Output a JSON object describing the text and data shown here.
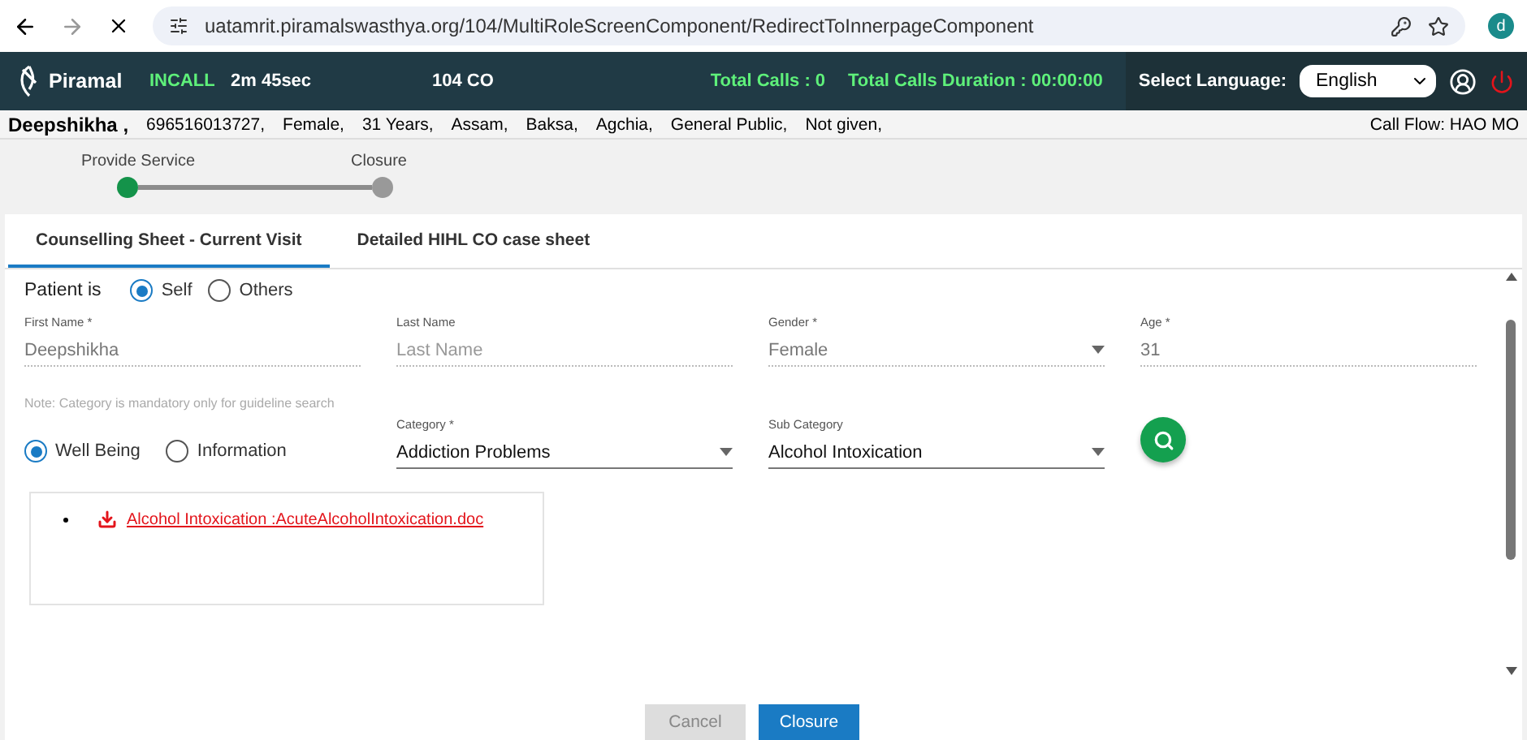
{
  "browser": {
    "url": "uatamrit.piramalswasthya.org/104/MultiRoleScreenComponent/RedirectToInnerpageComponent",
    "profile_initial": "d"
  },
  "header": {
    "brand": "Piramal",
    "call_status": "INCALL",
    "call_time": "2m 45sec",
    "role": "104 CO",
    "total_calls": "Total Calls : 0",
    "total_duration": "Total Calls Duration : 00:00:00",
    "language_label": "Select Language:",
    "language": "English"
  },
  "patient_strip": {
    "name": "Deepshikha ,",
    "details": [
      "696516013727,",
      "Female,",
      "31 Years,",
      "Assam,",
      "Baksa,",
      "Agchia,",
      "General Public,",
      "Not given,"
    ],
    "call_flow": "Call Flow: HAO MO"
  },
  "stepper": [
    {
      "label": "Provide Service",
      "selected": true
    },
    {
      "label": "Closure",
      "selected": false
    }
  ],
  "tabs": [
    {
      "label": "Counselling Sheet - Current Visit",
      "selected": true
    },
    {
      "label": "Detailed HIHL CO case sheet",
      "selected": false
    }
  ],
  "patient_is": {
    "label": "Patient is",
    "options": [
      {
        "label": "Self",
        "selected": true
      },
      {
        "label": "Others",
        "selected": false
      }
    ]
  },
  "fields": [
    {
      "label": "First Name *",
      "value": "Deepshikha",
      "kind": "readonly"
    },
    {
      "label": "Last Name",
      "placeholder": "Last Name",
      "kind": "readonly"
    },
    {
      "label": "Gender *",
      "value": "Female",
      "kind": "readonly-select"
    },
    {
      "label": "Age *",
      "value": "31",
      "kind": "readonly"
    }
  ],
  "note": "Note: Category is mandatory only for guideline search",
  "service_type": [
    {
      "label": "Well Being",
      "selected": true
    },
    {
      "label": "Information",
      "selected": false
    }
  ],
  "category_fields": [
    {
      "label": "Category *",
      "value": "Addiction Problems",
      "kind": "select"
    },
    {
      "label": "Sub Category",
      "value": "Alcohol Intoxication",
      "kind": "select"
    }
  ],
  "guidelines": [
    "Alcohol Intoxication :AcuteAlcoholIntoxication.doc"
  ],
  "buttons": [
    {
      "label": "Cancel",
      "disabled": true
    },
    {
      "label": "Closure",
      "disabled": false
    }
  ]
}
